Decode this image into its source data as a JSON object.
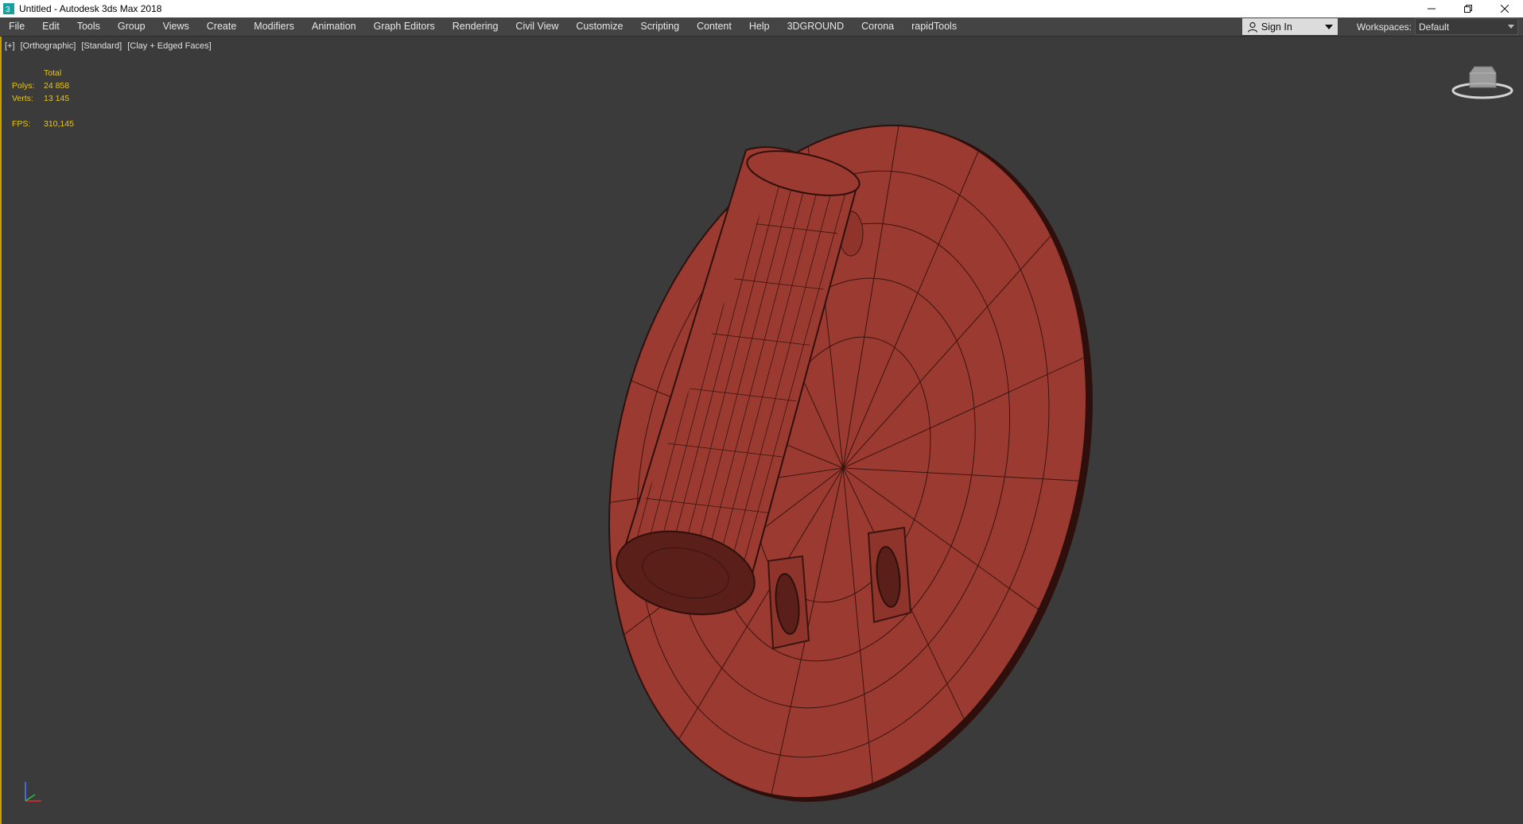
{
  "window": {
    "title": "Untitled - Autodesk 3ds Max 2018"
  },
  "menu": {
    "items": [
      "File",
      "Edit",
      "Tools",
      "Group",
      "Views",
      "Create",
      "Modifiers",
      "Animation",
      "Graph Editors",
      "Rendering",
      "Civil View",
      "Customize",
      "Scripting",
      "Content",
      "Help",
      "3DGROUND",
      "Corona",
      "rapidTools"
    ],
    "sign_in": "Sign In",
    "workspaces_label": "Workspaces:",
    "workspaces_value": "Default"
  },
  "viewport": {
    "labels": [
      "[+]",
      "[Orthographic]",
      "[Standard]",
      "[Clay + Edged Faces]"
    ],
    "stats": {
      "header": "Total",
      "polys_label": "Polys:",
      "polys_value": "24 858",
      "verts_label": "Verts:",
      "verts_value": "13 145",
      "fps_label": "FPS:",
      "fps_value": "310,145"
    },
    "model_color": "#9b3a30",
    "edge_color": "#3a1410",
    "background": "#3b3b3b"
  },
  "icons": [
    "app-3dsmax-icon",
    "minimize-icon",
    "restore-icon",
    "close-icon",
    "user-icon",
    "viewcube-icon",
    "axis-tripod-icon"
  ]
}
